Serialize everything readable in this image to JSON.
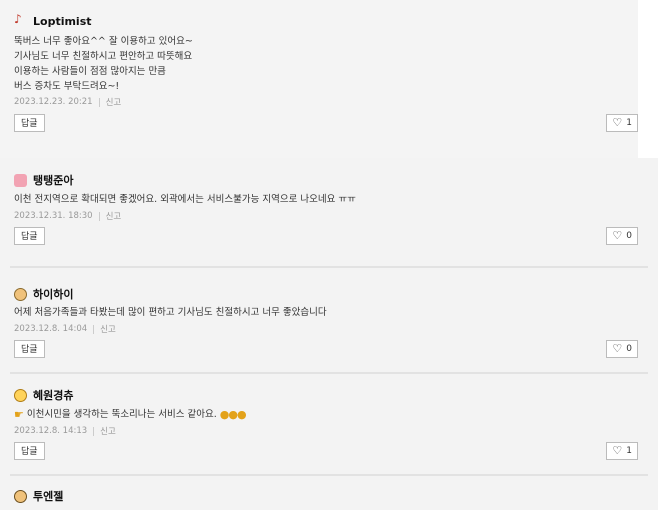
{
  "comments": [
    {
      "author": "Loptimist",
      "avatar": "music-notes-icon",
      "text": "뚝버스 너무 좋아요^^ 잘 이용하고 있어요~\n기사님도 너무 친절하시고 편안하고 따뜻해요\n이용하는 사람들이 점점 많아지는 만큼\n버스 증차도 부탁드려요~!",
      "date": "2023.12.23. 20:21",
      "report": "신고",
      "reply": "답글",
      "likes": "1"
    },
    {
      "author": "탱탱준아",
      "avatar": "pig-icon",
      "text": "이천 전지역으로 확대되면 좋겠어요. 외곽에서는 서비스불가능 지역으로 나오네요 ㅠㅠ",
      "date": "2023.12.31. 18:30",
      "report": "신고",
      "reply": "답글",
      "likes": "0"
    },
    {
      "author": "하이하이",
      "avatar": "face-icon",
      "text": "어제 처음가족들과 타봤는데 많이 편하고 기사님도 친절하시고 너무 좋았습니다",
      "date": "2023.12.8. 14:04",
      "report": "신고",
      "reply": "답글",
      "likes": "0"
    },
    {
      "author": "혜원경츄",
      "avatar": "smile-face-icon",
      "text": "이천시민을 생각하는 뚝소리나는 서비스 같아요.",
      "date": "2023.12.8. 14:13",
      "report": "신고",
      "reply": "답글",
      "likes": "1"
    },
    {
      "author": "투엔젤",
      "avatar": "face-icon"
    }
  ]
}
